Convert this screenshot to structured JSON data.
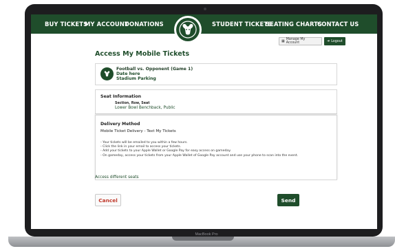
{
  "nav": {
    "items_left": [
      "BUY TICKETS",
      "MY ACCOUNT",
      "DONATIONS"
    ],
    "items_right": [
      "STUDENT TICKETS",
      "SEATING CHARTS",
      "CONTACT US"
    ]
  },
  "top_actions": {
    "manage_label": "Manage My Account",
    "logout_label": "Logout"
  },
  "page": {
    "title": "Access My Mobile Tickets"
  },
  "event": {
    "title": "Football vs. Opponent (Game 1)",
    "date": "Date here",
    "venue": "Stadium Parking"
  },
  "seat": {
    "heading": "Seat Information",
    "sub_label": "Section, Row, Seat",
    "value": "Lower Bowl Benchback, Public"
  },
  "delivery": {
    "heading": "Delivery Method",
    "method": "Mobile Ticket Delivery - Text My Tickets",
    "instructions": [
      "- Your tickets will be emailed to you within a few hours.",
      "- Click the link in your email to access your tickets.",
      "- Add your tickets to your Apple Wallet or Google Pay for easy access on gameday.",
      "- On gameday, access your tickets from your Apple Wallet of Google Pay account and use your phone to scan into the event."
    ]
  },
  "links": {
    "access_different": "Access different seats"
  },
  "actions": {
    "cancel_label": "Cancel",
    "send_label": "Send"
  },
  "device": {
    "label": "MacBook Pro"
  },
  "colors": {
    "brand_green": "#1f4d2b",
    "cancel_red": "#c0392b"
  }
}
